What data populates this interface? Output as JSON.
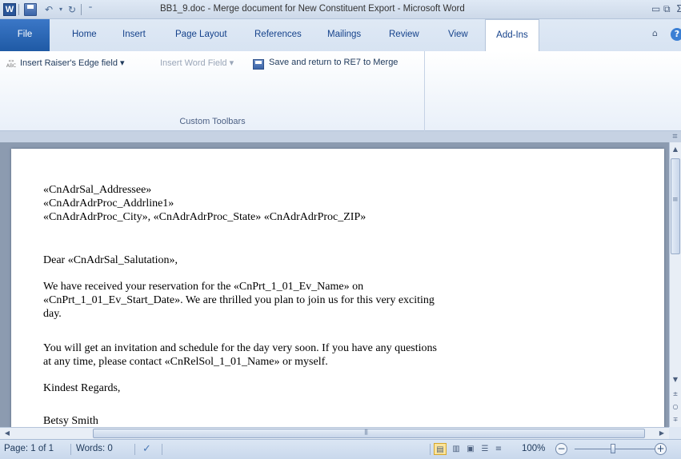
{
  "titlebar": {
    "app_logo": "W",
    "title": "BB1_9.doc - Merge document for New Constituent Export - Microsoft Word",
    "qat": [
      "save-icon",
      "undo-icon",
      "redo-icon"
    ],
    "window_controls": [
      "minimize-icon",
      "restore-icon",
      "close-icon"
    ]
  },
  "tabs": [
    {
      "label": "File"
    },
    {
      "label": "Home"
    },
    {
      "label": "Insert"
    },
    {
      "label": "Page Layout"
    },
    {
      "label": "References"
    },
    {
      "label": "Mailings"
    },
    {
      "label": "Review"
    },
    {
      "label": "View"
    },
    {
      "label": "Add-Ins",
      "active": true
    }
  ],
  "ribbon": {
    "insert_re_field": "Insert Raiser's Edge field ▾",
    "insert_word_field": "Insert Word Field ▾",
    "save_return": "Save and return to RE7 to Merge",
    "group_label": "Custom Toolbars"
  },
  "document": {
    "lines": [
      "«CnAdrSal_Addressee»",
      "«CnAdrAdrProc_Addrline1»",
      "«CnAdrAdrProc_City», «CnAdrAdrProc_State» «CnAdrAdrProc_ZIP»",
      "Dear «CnAdrSal_Salutation»,",
      "We have received your reservation for the «CnPrt_1_01_Ev_Name» on",
      "«CnPrt_1_01_Ev_Start_Date». We are thrilled you plan to join us for this very exciting",
      "day.",
      "You will get an invitation and schedule for the day very soon. If you have any questions",
      "at any time, please contact «CnRelSol_1_01_Name» or myself.",
      "Kindest Regards,",
      "Betsy Smith"
    ]
  },
  "statusbar": {
    "page": "Page: 1 of 1",
    "words": "Words: 0",
    "zoom": "100%",
    "zoom_value_percent": 100
  },
  "colors": {
    "file_tab": "#2a62ad",
    "chrome": "#c6d2e3",
    "active_view": "#fbe49b"
  }
}
